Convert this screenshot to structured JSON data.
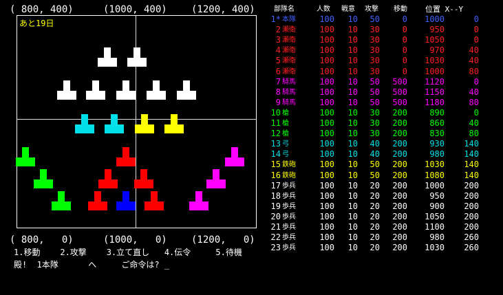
{
  "map": {
    "top_coords": [
      "( 800, 400)",
      "(1000, 400)",
      "(1200, 400)"
    ],
    "bottom_coords": [
      "( 800,   0)",
      "(1000,   0)",
      "(1200,   0)"
    ],
    "days_left": "あと19日"
  },
  "units_on_map": [
    {
      "color": "#ffffff",
      "col": 155,
      "row": 68
    },
    {
      "color": "#ffffff",
      "col": 198,
      "row": 68
    },
    {
      "color": "#ffffff",
      "col": 96,
      "row": 116
    },
    {
      "color": "#ffffff",
      "col": 138,
      "row": 116
    },
    {
      "color": "#ffffff",
      "col": 182,
      "row": 116
    },
    {
      "color": "#ffffff",
      "col": 226,
      "row": 116
    },
    {
      "color": "#ffffff",
      "col": 270,
      "row": 116
    },
    {
      "color": "#00e0e8",
      "col": 122,
      "row": 165
    },
    {
      "color": "#00e0e8",
      "col": 165,
      "row": 165
    },
    {
      "color": "#ffff00",
      "col": 209,
      "row": 165
    },
    {
      "color": "#ffff00",
      "col": 252,
      "row": 165
    },
    {
      "color": "#00ff00",
      "col": 36,
      "row": 213
    },
    {
      "color": "#00ff00",
      "col": 62,
      "row": 245
    },
    {
      "color": "#00ff00",
      "col": 88,
      "row": 277
    },
    {
      "color": "#ff0000",
      "col": 182,
      "row": 213
    },
    {
      "color": "#ff0000",
      "col": 156,
      "row": 245
    },
    {
      "color": "#ff0000",
      "col": 208,
      "row": 245
    },
    {
      "color": "#ff0000",
      "col": 141,
      "row": 277
    },
    {
      "color": "#0000ff",
      "col": 182,
      "row": 277
    },
    {
      "color": "#ff0000",
      "col": 223,
      "row": 277
    },
    {
      "color": "#ff00ff",
      "col": 340,
      "row": 213
    },
    {
      "color": "#ff00ff",
      "col": 313,
      "row": 245
    },
    {
      "color": "#ff00ff",
      "col": 288,
      "row": 277
    }
  ],
  "command_line": "1.移動    2.攻撃    3.立て直し   4.伝令     5.待機",
  "prompt_line": "殿!  1本隊      へ     ご命令は? _",
  "roster": {
    "headers": [
      "部隊名",
      "人数",
      "戦意",
      "攻撃",
      "移動",
      "位置 X--Y"
    ],
    "rows": [
      {
        "id": "1*",
        "name": "本隊",
        "n": "100",
        "m": "10",
        "a": "50",
        "mv": "0",
        "x": "1000",
        "y": "0",
        "color": "#4060ff"
      },
      {
        "id": "2",
        "name": "瀬衛",
        "n": "100",
        "m": "10",
        "a": "30",
        "mv": "0",
        "x": "950",
        "y": "0",
        "color": "#ff2020"
      },
      {
        "id": "3",
        "name": "瀬衛",
        "n": "100",
        "m": "10",
        "a": "30",
        "mv": "0",
        "x": "1050",
        "y": "0",
        "color": "#ff2020"
      },
      {
        "id": "4",
        "name": "瀬衛",
        "n": "100",
        "m": "10",
        "a": "30",
        "mv": "0",
        "x": "970",
        "y": "40",
        "color": "#ff2020"
      },
      {
        "id": "5",
        "name": "瀬衛",
        "n": "100",
        "m": "10",
        "a": "30",
        "mv": "0",
        "x": "1030",
        "y": "40",
        "color": "#ff2020"
      },
      {
        "id": "6",
        "name": "瀬衛",
        "n": "100",
        "m": "10",
        "a": "30",
        "mv": "0",
        "x": "1000",
        "y": "80",
        "color": "#ff2020"
      },
      {
        "id": "7",
        "name": "騎馬",
        "n": "100",
        "m": "10",
        "a": "50",
        "mv": "500",
        "x": "1120",
        "y": "0",
        "color": "#ff00ff"
      },
      {
        "id": "8",
        "name": "騎馬",
        "n": "100",
        "m": "10",
        "a": "50",
        "mv": "500",
        "x": "1150",
        "y": "40",
        "color": "#ff00ff"
      },
      {
        "id": "9",
        "name": "騎馬",
        "n": "100",
        "m": "10",
        "a": "50",
        "mv": "500",
        "x": "1180",
        "y": "80",
        "color": "#ff00ff"
      },
      {
        "id": "10",
        "name": "槍",
        "n": "100",
        "m": "10",
        "a": "30",
        "mv": "200",
        "x": "890",
        "y": "0",
        "color": "#00ff00"
      },
      {
        "id": "11",
        "name": "槍",
        "n": "100",
        "m": "10",
        "a": "30",
        "mv": "200",
        "x": "860",
        "y": "40",
        "color": "#00ff00"
      },
      {
        "id": "12",
        "name": "槍",
        "n": "100",
        "m": "10",
        "a": "30",
        "mv": "200",
        "x": "830",
        "y": "80",
        "color": "#00ff00"
      },
      {
        "id": "13",
        "name": "弓",
        "n": "100",
        "m": "10",
        "a": "40",
        "mv": "200",
        "x": "930",
        "y": "140",
        "color": "#00e0e8"
      },
      {
        "id": "14",
        "name": "弓",
        "n": "100",
        "m": "10",
        "a": "40",
        "mv": "200",
        "x": "980",
        "y": "140",
        "color": "#00e0e8"
      },
      {
        "id": "15",
        "name": "鉄砲",
        "n": "100",
        "m": "10",
        "a": "50",
        "mv": "200",
        "x": "1030",
        "y": "140",
        "color": "#ffff00"
      },
      {
        "id": "16",
        "name": "鉄砲",
        "n": "100",
        "m": "10",
        "a": "50",
        "mv": "200",
        "x": "1080",
        "y": "140",
        "color": "#ffff00"
      },
      {
        "id": "17",
        "name": "歩兵",
        "n": "100",
        "m": "10",
        "a": "20",
        "mv": "200",
        "x": "1000",
        "y": "200",
        "color": "#ffffff"
      },
      {
        "id": "18",
        "name": "歩兵",
        "n": "100",
        "m": "10",
        "a": "20",
        "mv": "200",
        "x": "950",
        "y": "200",
        "color": "#ffffff"
      },
      {
        "id": "19",
        "name": "歩兵",
        "n": "100",
        "m": "10",
        "a": "20",
        "mv": "200",
        "x": "900",
        "y": "200",
        "color": "#ffffff"
      },
      {
        "id": "20",
        "name": "歩兵",
        "n": "100",
        "m": "10",
        "a": "20",
        "mv": "200",
        "x": "1050",
        "y": "200",
        "color": "#ffffff"
      },
      {
        "id": "21",
        "name": "歩兵",
        "n": "100",
        "m": "10",
        "a": "20",
        "mv": "200",
        "x": "1100",
        "y": "200",
        "color": "#ffffff"
      },
      {
        "id": "22",
        "name": "歩兵",
        "n": "100",
        "m": "10",
        "a": "20",
        "mv": "200",
        "x": "980",
        "y": "260",
        "color": "#ffffff"
      },
      {
        "id": "23",
        "name": "歩兵",
        "n": "100",
        "m": "10",
        "a": "20",
        "mv": "200",
        "x": "1030",
        "y": "260",
        "color": "#ffffff"
      }
    ]
  }
}
